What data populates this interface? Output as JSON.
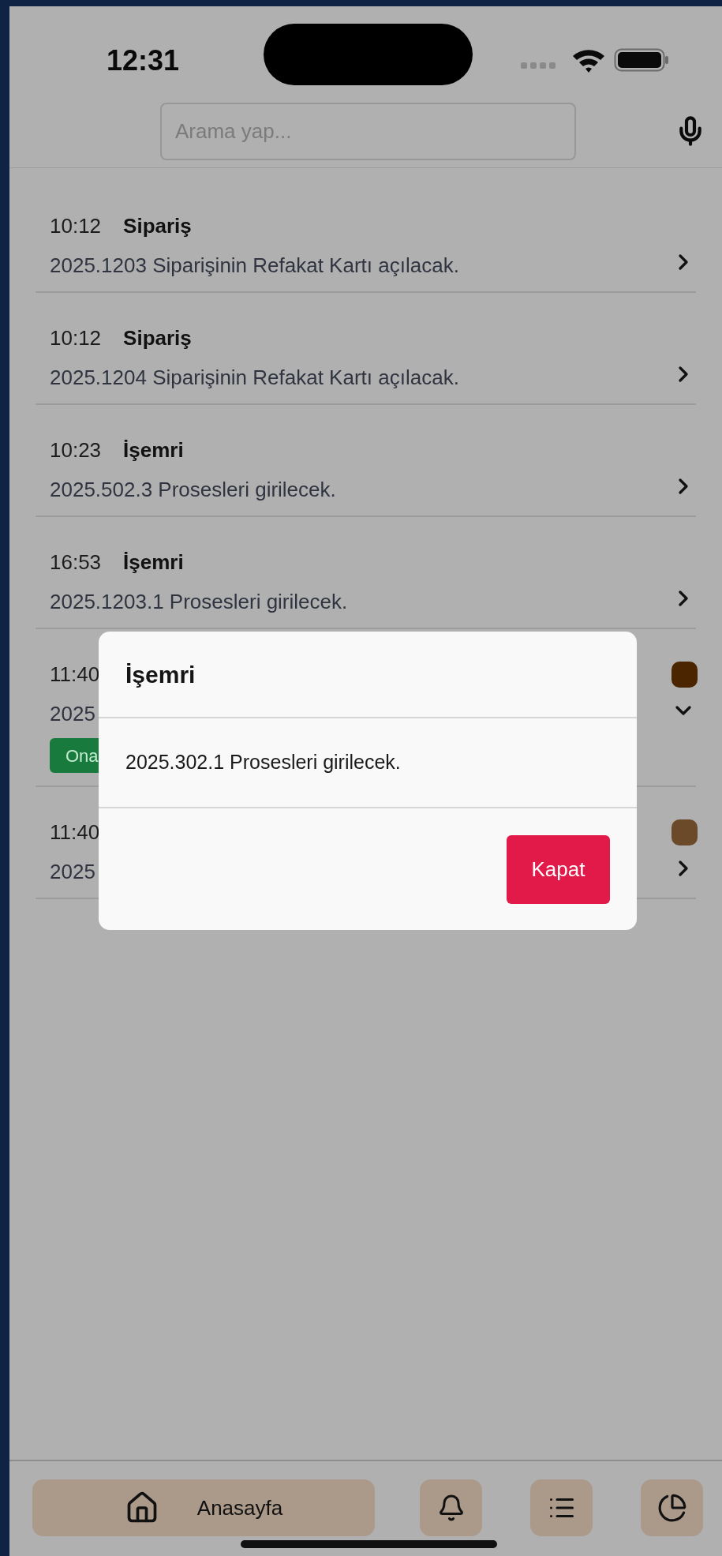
{
  "status_bar": {
    "time": "12:31"
  },
  "search": {
    "placeholder": "Arama yap..."
  },
  "tasks": [
    {
      "time": "10:12",
      "category": "Sipariş",
      "description": "2025.1203 Siparişinin Refakat Kartı açılacak.",
      "expanded": false
    },
    {
      "time": "10:12",
      "category": "Sipariş",
      "description": "2025.1204 Siparişinin Refakat Kartı açılacak.",
      "expanded": false
    },
    {
      "time": "10:23",
      "category": "İşemri",
      "description": "2025.502.3 Prosesleri girilecek.",
      "expanded": false
    },
    {
      "time": "16:53",
      "category": "İşemri",
      "description": "2025.1203.1 Prosesleri girilecek.",
      "expanded": false
    },
    {
      "time": "11:40",
      "description": "2025",
      "expanded": true,
      "badge": "Ona",
      "color": "#4a2500"
    },
    {
      "time": "11:40",
      "description": "2025",
      "expanded": false,
      "color": "#6b4a2a"
    }
  ],
  "dialog": {
    "title": "İşemri",
    "message": "2025.302.1 Prosesleri girilecek.",
    "button": "Kapat"
  },
  "nav": [
    {
      "kind": "home",
      "label": "Anasayfa"
    },
    {
      "kind": "bell"
    },
    {
      "kind": "list"
    },
    {
      "kind": "chart"
    }
  ]
}
